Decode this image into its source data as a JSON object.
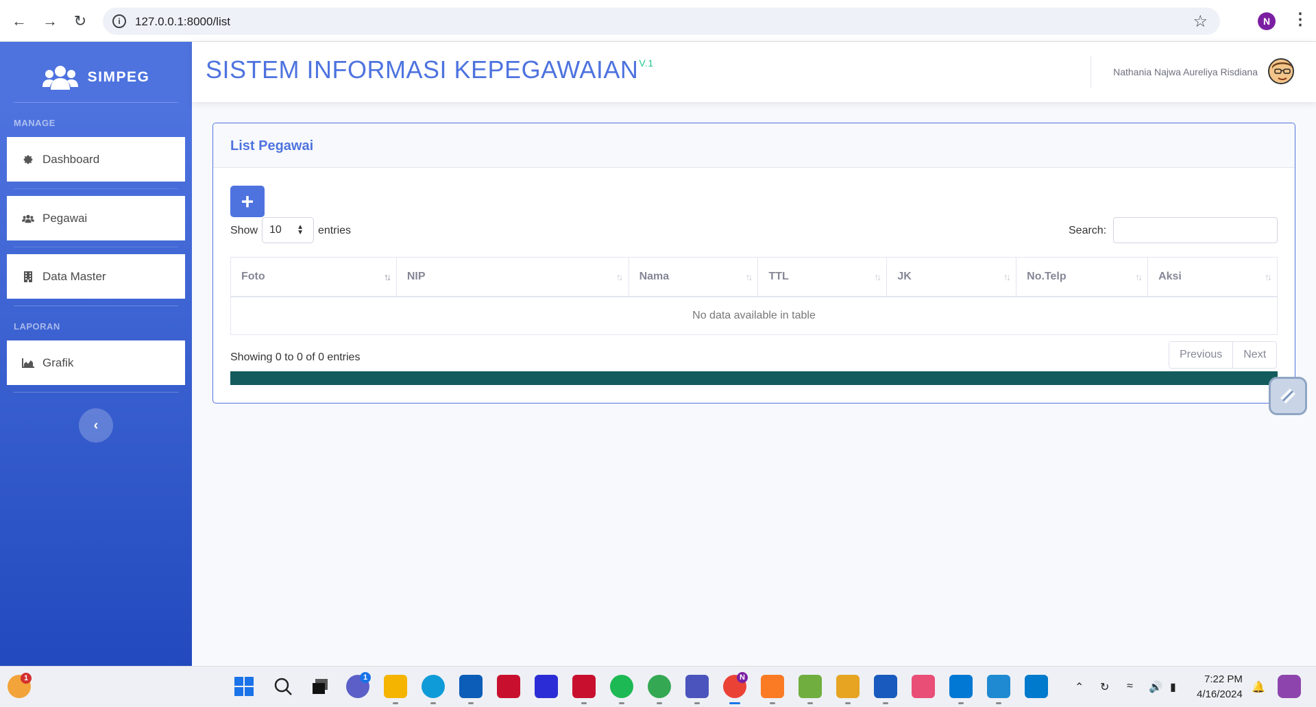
{
  "browser": {
    "url": "127.0.0.1:8000/list",
    "profile_initial": "N"
  },
  "sidebar": {
    "brand": "SIMPEG",
    "heading_manage": "MANAGE",
    "items": [
      {
        "label": "Dashboard",
        "icon": "gear-icon"
      },
      {
        "label": "Pegawai",
        "icon": "users-icon"
      },
      {
        "label": "Data Master",
        "icon": "building-icon"
      }
    ],
    "heading_laporan": "LAPORAN",
    "report_items": [
      {
        "label": "Grafik",
        "icon": "area-chart-icon"
      }
    ],
    "toggle_label": "‹"
  },
  "topbar": {
    "title": "SISTEM INFORMASI KEPEGAWAIAN",
    "version": "V.1",
    "user_name": "Nathania Najwa Aureliya Risdiana"
  },
  "card": {
    "title": "List Pegawai",
    "add_label": "+",
    "show_label": "Show",
    "entries_value": "10",
    "entries_label": "entries",
    "search_label": "Search:",
    "search_value": "",
    "columns": [
      "Foto",
      "NIP",
      "Nama",
      "TTL",
      "JK",
      "No.Telp",
      "Aksi"
    ],
    "empty_message": "No data available in table",
    "info": "Showing 0 to 0 of 0 entries",
    "prev_label": "Previous",
    "next_label": "Next"
  },
  "taskbar": {
    "time": "7:22 PM",
    "date": "4/16/2024",
    "weather_badge": "1",
    "chat_badge": "1",
    "chrome_profile_badge": "N"
  },
  "colors": {
    "primary": "#4e73df",
    "sidebar_dark": "#224abe",
    "success": "#1cc88a",
    "bar": "#135b5c"
  }
}
